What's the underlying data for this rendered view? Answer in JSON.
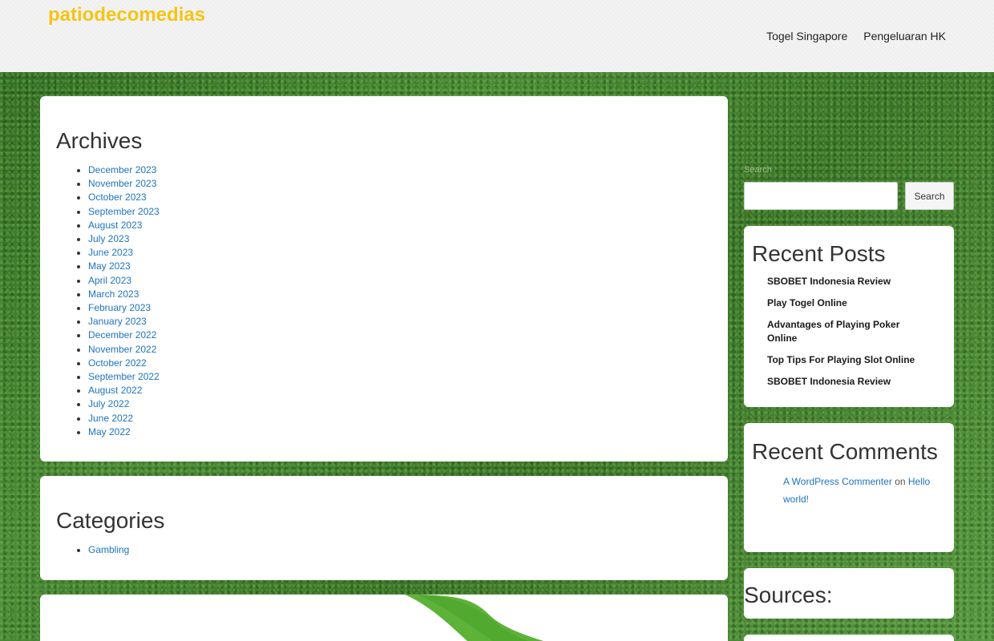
{
  "header": {
    "site_title": "patiodecomedias",
    "nav": [
      "Togel Singapore",
      "Pengeluaran HK"
    ]
  },
  "archives": {
    "title": "Archives",
    "items": [
      "December 2023",
      "November 2023",
      "October 2023",
      "September 2023",
      "August 2023",
      "July 2023",
      "June 2023",
      "May 2023",
      "April 2023",
      "March 2023",
      "February 2023",
      "January 2023",
      "December 2022",
      "November 2022",
      "October 2022",
      "September 2022",
      "August 2022",
      "July 2022",
      "June 2022",
      "May 2022"
    ]
  },
  "categories": {
    "title": "Categories",
    "items": [
      "Gambling"
    ]
  },
  "search": {
    "label": "Search",
    "button_label": "Search",
    "input_value": ""
  },
  "recent_posts": {
    "title": "Recent Posts",
    "items": [
      "SBOBET Indonesia Review",
      "Play Togel Online",
      "Advantages of Playing Poker Online",
      "Top Tips For Playing Slot Online",
      "SBOBET Indonesia Review"
    ]
  },
  "recent_comments": {
    "title": "Recent Comments",
    "author": "A WordPress Commenter",
    "connector": "on",
    "post": "Hello world!"
  },
  "sources": {
    "title": "Sources:"
  },
  "colors": {
    "title_yellow": "#f4c514",
    "link_blue": "#1e73be",
    "grass_green": "#3f7a2e",
    "accent_green": "#5cb338"
  }
}
